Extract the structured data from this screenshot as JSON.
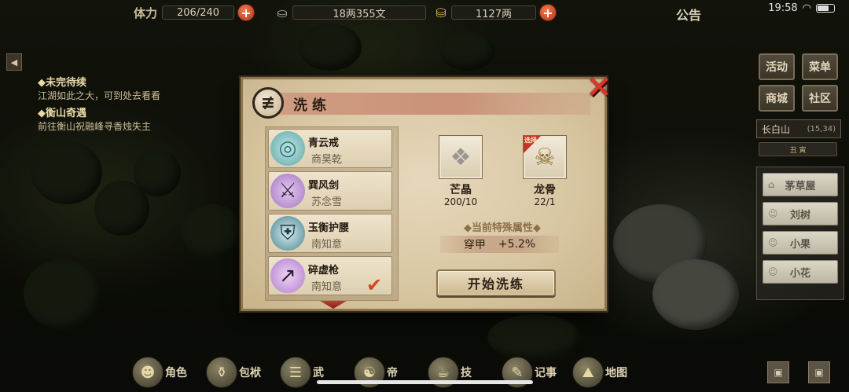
{
  "status": {
    "time": "19:58"
  },
  "topbar": {
    "stamina_label": "体力",
    "stamina_value": "206/240",
    "silver_value": "18两355文",
    "gold_value": "1127两",
    "notice_label": "公告"
  },
  "quests": [
    {
      "title": "◆未完待续",
      "desc": "江湖如此之大，可到处去看看"
    },
    {
      "title": "◆衡山奇遇",
      "desc": "前往衡山祝融峰寻香烛失主"
    }
  ],
  "side_menu": {
    "activity": "活动",
    "menu": "菜单",
    "shop": "商城",
    "community": "社区"
  },
  "location": {
    "name": "长白山",
    "coord": "(15,34)",
    "time_marks": "丑 寅"
  },
  "npcs": [
    "茅草屋",
    "刘树",
    "小果",
    "小花"
  ],
  "bottom_nav": [
    {
      "label": "角色",
      "icon": "character-icon"
    },
    {
      "label": "包袱",
      "icon": "bag-icon"
    },
    {
      "label": "武",
      "icon": "martial-icon"
    },
    {
      "label": "帝",
      "icon": "emperor-icon"
    },
    {
      "label": "技",
      "icon": "skill-icon"
    },
    {
      "label": "记事",
      "icon": "journal-icon"
    },
    {
      "label": "地图",
      "icon": "map-icon"
    }
  ],
  "dialog": {
    "title": "洗练",
    "items": [
      {
        "name": "青云戒",
        "owner": "商昊乾",
        "icon": "ring-icon",
        "selected": false
      },
      {
        "name": "巽风剑",
        "owner": "苏念雪",
        "icon": "sword-icon",
        "selected": false
      },
      {
        "name": "玉衡护腰",
        "owner": "南知意",
        "icon": "armor-icon",
        "selected": false
      },
      {
        "name": "碎虚枪",
        "owner": "南知意",
        "icon": "spear-icon",
        "selected": true
      }
    ],
    "materials": [
      {
        "name": "芒晶",
        "count": "200/10",
        "icon": "crystal-icon",
        "tag": ""
      },
      {
        "name": "龙骨",
        "count": "22/1",
        "icon": "dragon-bone-icon",
        "tag": "选择"
      }
    ],
    "attr_title": "◆当前特殊属性◆",
    "attr_name": "穿甲",
    "attr_value": "+5.2%",
    "start_button": "开始洗练"
  },
  "colors": {
    "accent_red": "#e0332a",
    "parchment": "#e6d8bb",
    "frame_brown": "#8c7550"
  }
}
